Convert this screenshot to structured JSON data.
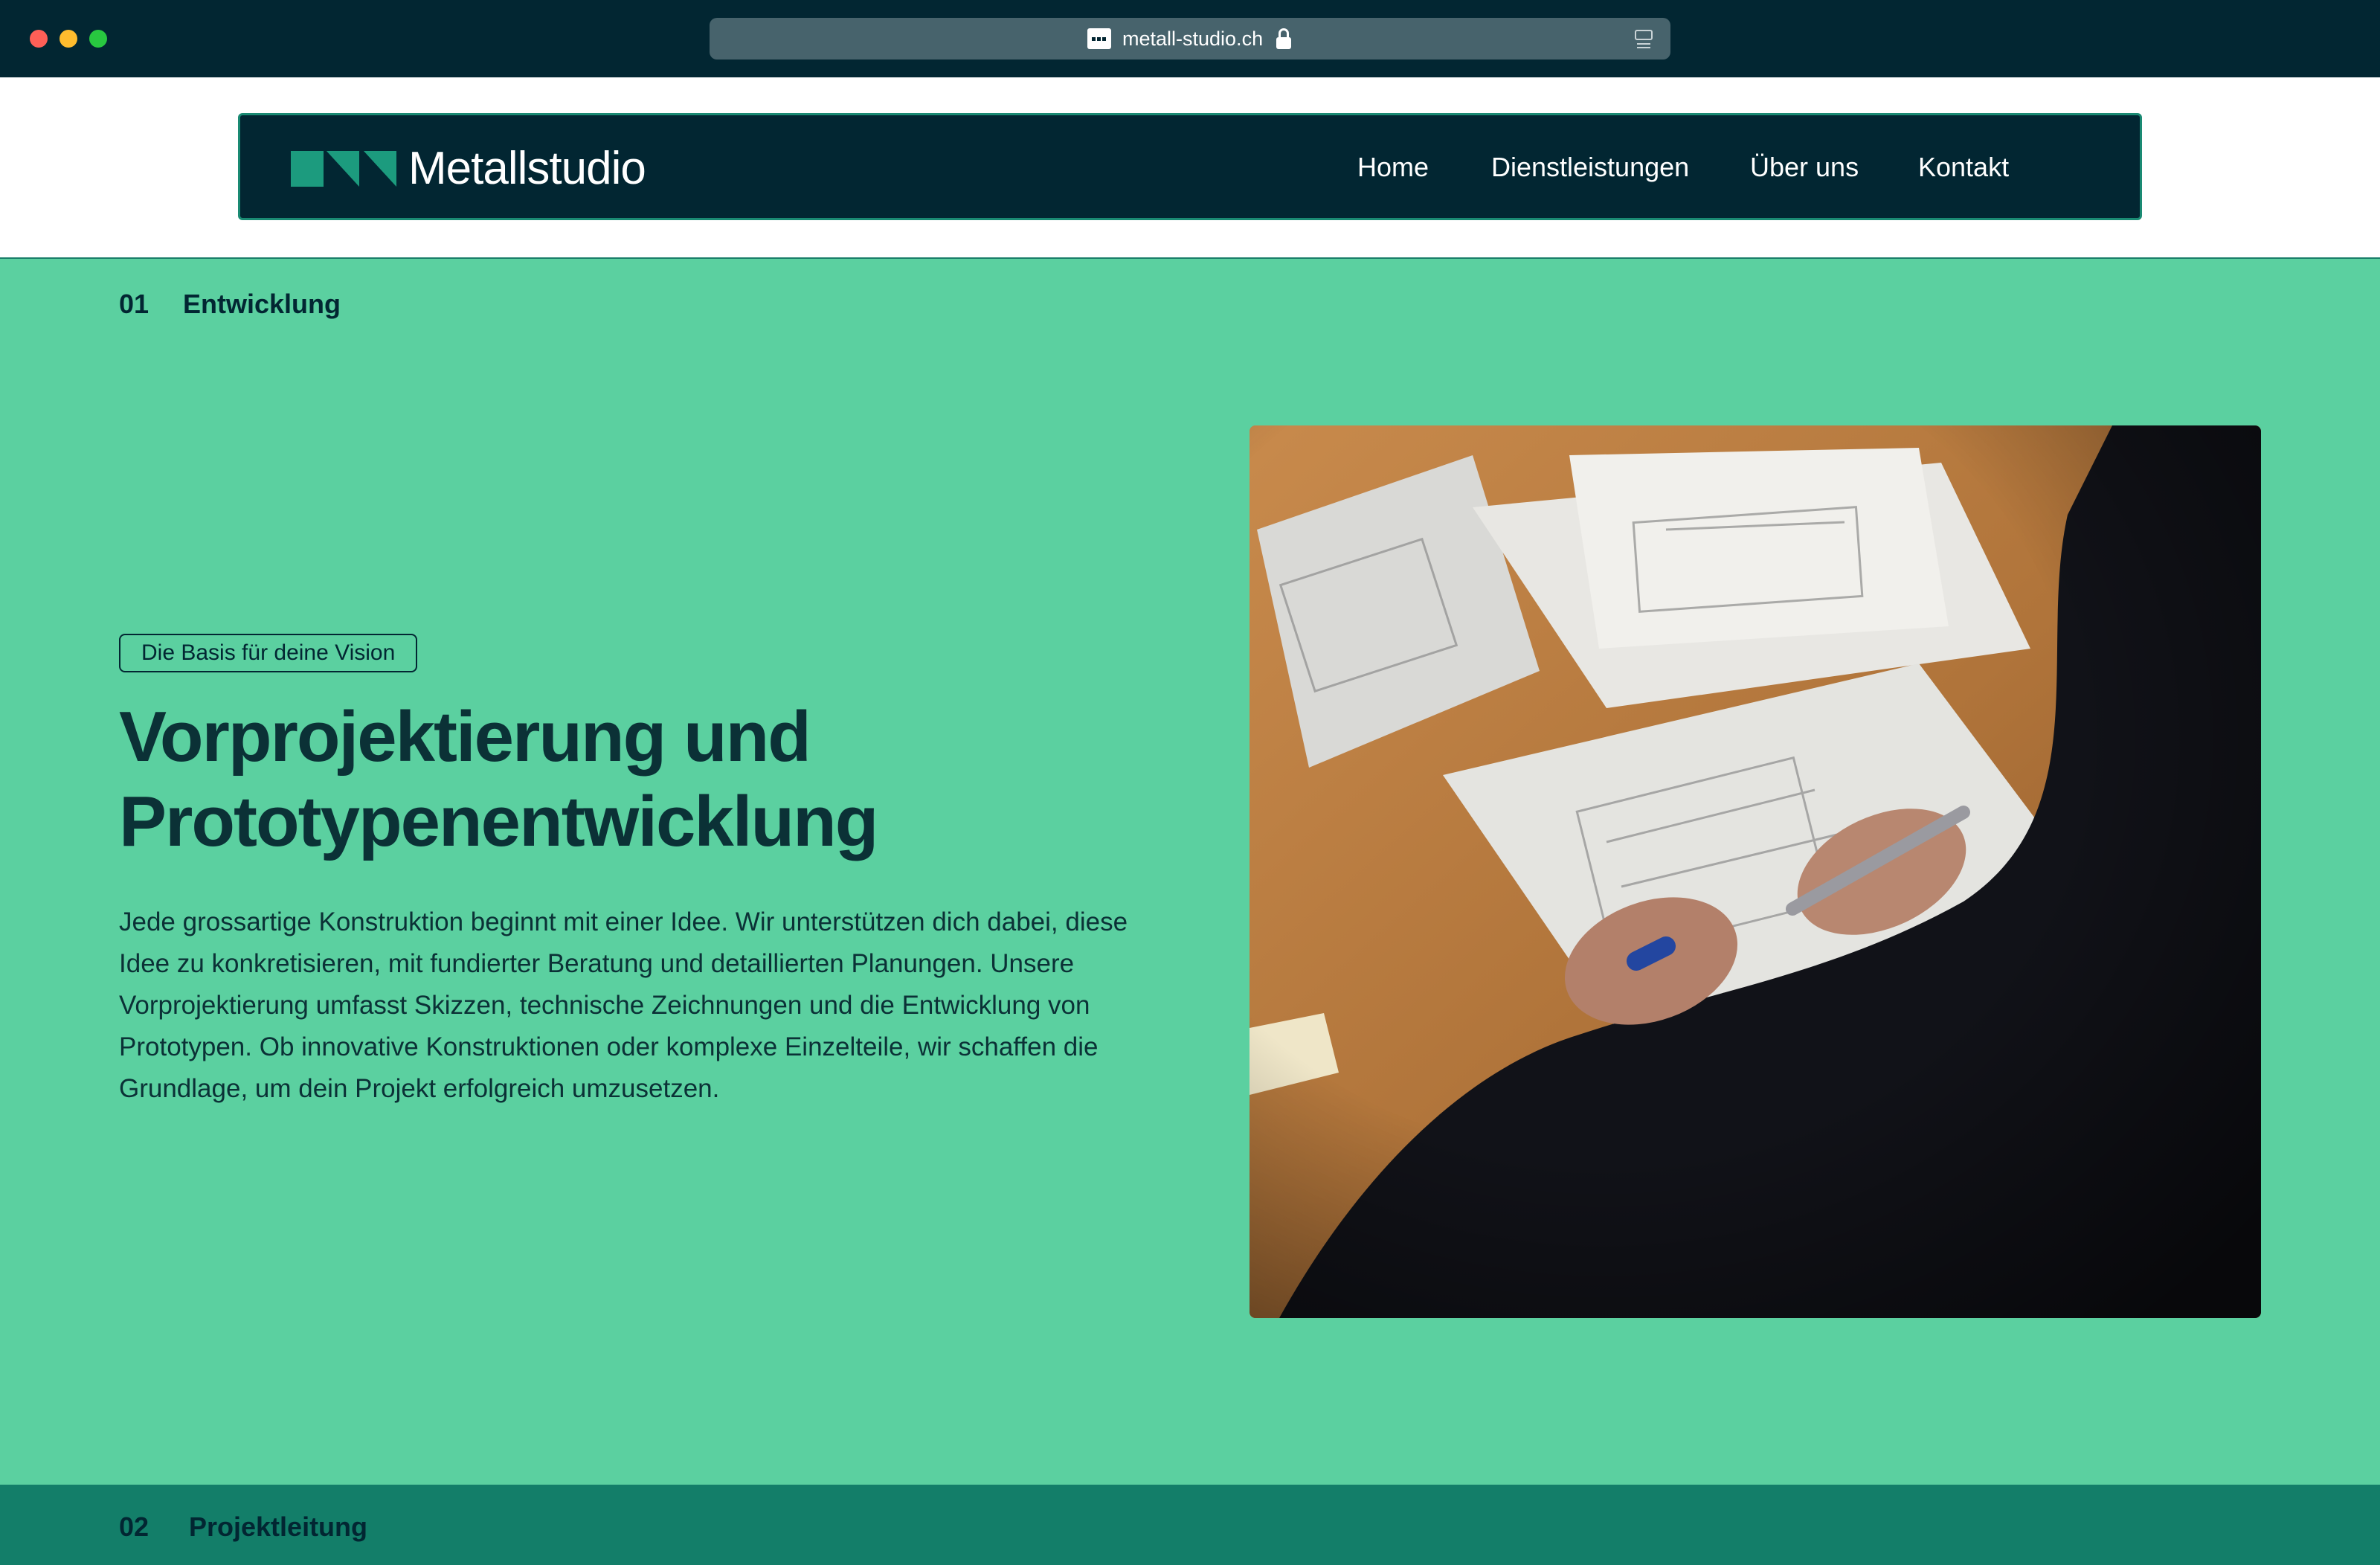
{
  "browser": {
    "url": "metall-studio.ch",
    "icons": [
      "favicon",
      "lock-icon",
      "reader-icon"
    ]
  },
  "header": {
    "logo_text": "Metallstudio",
    "nav": [
      {
        "label": "Home"
      },
      {
        "label": "Dienstleistungen"
      },
      {
        "label": "Über uns"
      },
      {
        "label": "Kontakt"
      }
    ]
  },
  "sections": [
    {
      "number": "01",
      "title": "Entwicklung",
      "tag": "Die Basis für deine Vision",
      "headline": "Vorprojektierung und Prototypenentwicklung",
      "body": "Jede grossartige Konstruktion beginnt mit einer Idee. Wir unterstützen dich dabei, diese Idee zu konkretisieren, mit fundierter Beratung und detaillierten Planungen. Unsere Vorprojektierung umfasst Skizzen, technische Zeichnungen und die Entwicklung von Prototypen. Ob innovative Konstruktionen oder komplexe Einzelteile, wir schaffen die Grundlage, um dein Projekt erfolgreich umzusetzen."
    },
    {
      "number": "02",
      "title": "Projektleitung"
    }
  ],
  "colors": {
    "dark": "#022632",
    "accent_green": "#5bd0a0",
    "teal": "#137e69",
    "logo_green": "#1c9b7e"
  }
}
